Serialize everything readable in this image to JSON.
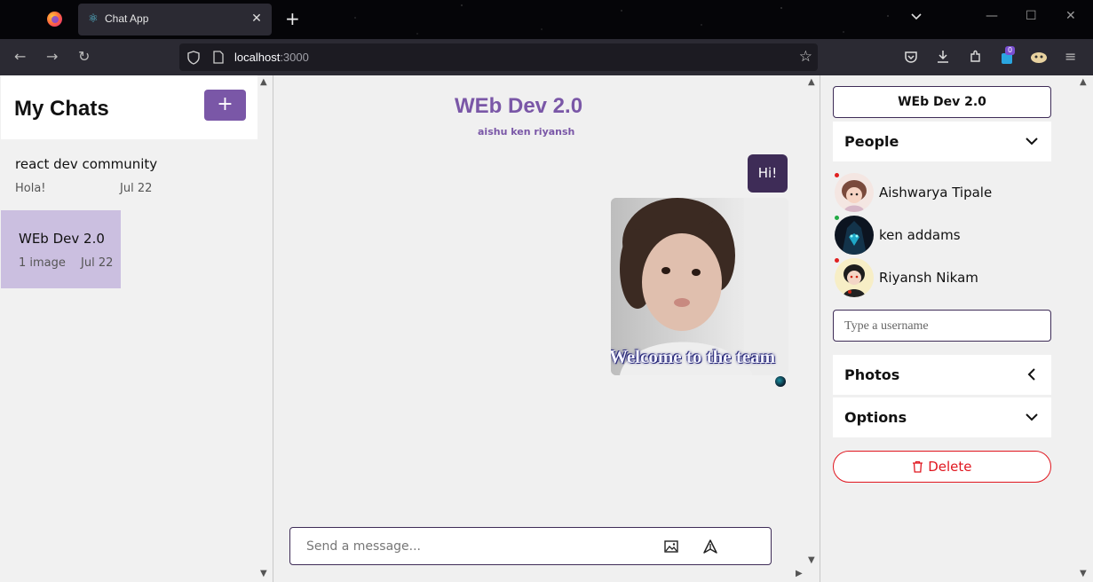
{
  "browser": {
    "tab_title": "Chat App",
    "url_host": "localhost",
    "url_port": ":3000",
    "extension_badge": "0"
  },
  "sidebar": {
    "title": "My Chats",
    "add_button": "+",
    "chats": [
      {
        "name": "react dev community",
        "last_message": "Hola!",
        "date": "Jul 22"
      },
      {
        "name": "WEb Dev 2.0",
        "last_message": "1 image",
        "date": "Jul 22"
      }
    ]
  },
  "chat": {
    "title": "WEb Dev 2.0",
    "members": "aishu ken riyansh",
    "messages": [
      {
        "type": "text",
        "text": "Hi!"
      },
      {
        "type": "image",
        "caption": "Welcome to the team"
      }
    ],
    "composer_placeholder": "Send a message..."
  },
  "details": {
    "group_name": "WEb Dev 2.0",
    "people_label": "People",
    "people": [
      {
        "name": "Aishwarya Tipale",
        "status_color": "#e02020"
      },
      {
        "name": "ken addams",
        "status_color": "#22aa44"
      },
      {
        "name": "Riyansh Nikam",
        "status_color": "#e02020"
      }
    ],
    "username_placeholder": "Type a username",
    "photos_label": "Photos",
    "options_label": "Options",
    "delete_label": "Delete"
  },
  "colors": {
    "accent": "#7a57a7",
    "bubble": "#3e2c57",
    "selected_chat": "#cbbfe0",
    "danger": "#e0161f"
  }
}
